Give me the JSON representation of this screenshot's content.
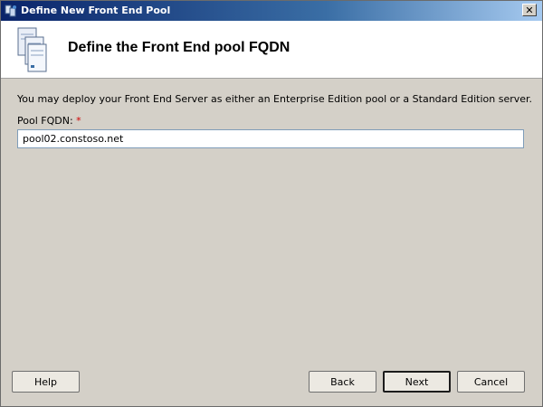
{
  "window": {
    "title": "Define New Front End Pool",
    "title_icon": "wizard-server-icon",
    "close_glyph": "✕"
  },
  "header": {
    "title": "Define the Front End pool FQDN",
    "icon": "server-pool-icon"
  },
  "content": {
    "description": "You may deploy your Front End Server as either an Enterprise Edition pool or a Standard Edition server.",
    "fqdn_label": "Pool FQDN:",
    "required_marker": "*",
    "fqdn_value": "pool02.constoso.net"
  },
  "buttons": {
    "help": "Help",
    "back": "Back",
    "next": "Next",
    "cancel": "Cancel"
  },
  "colors": {
    "titlebar_start": "#0a246a",
    "background": "#d4d0c8",
    "required": "#d00000"
  }
}
